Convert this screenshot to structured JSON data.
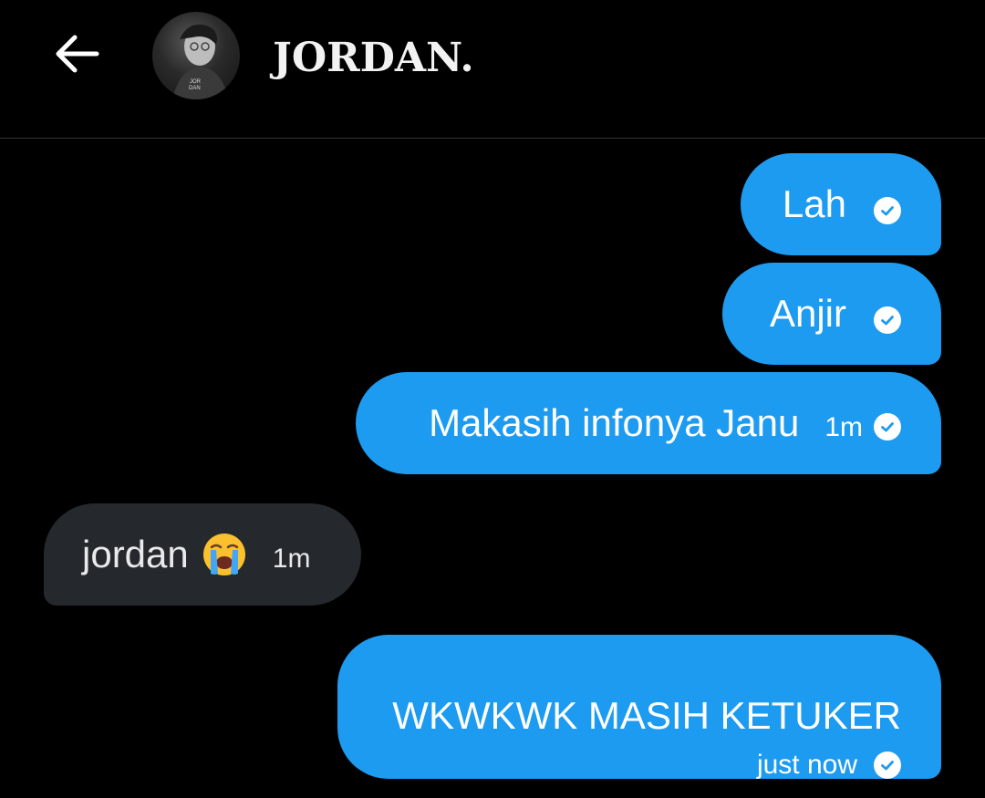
{
  "header": {
    "title": "JORDAN.",
    "back_icon": "arrow-left-icon",
    "avatar_icon": "profile-avatar"
  },
  "messages": [
    {
      "text": "Lah",
      "direction": "sent",
      "time": "",
      "status_icon": "check-circle-icon"
    },
    {
      "text": "Anjir",
      "direction": "sent",
      "time": "",
      "status_icon": "check-circle-icon"
    },
    {
      "text": "Makasih infonya Janu",
      "direction": "sent",
      "time": "1m",
      "status_icon": "check-circle-icon"
    },
    {
      "text": "jordan",
      "direction": "received",
      "time": "1m",
      "emoji": "loudly-crying-face-emoji"
    },
    {
      "text": "WKWKWK MASIH KETUKER",
      "direction": "sent",
      "time": "just now",
      "status_icon": "check-circle-icon"
    }
  ],
  "colors": {
    "background": "#000000",
    "sent_bubble": "#1d9bf0",
    "received_bubble": "#25292d",
    "divider": "#2f3336"
  }
}
